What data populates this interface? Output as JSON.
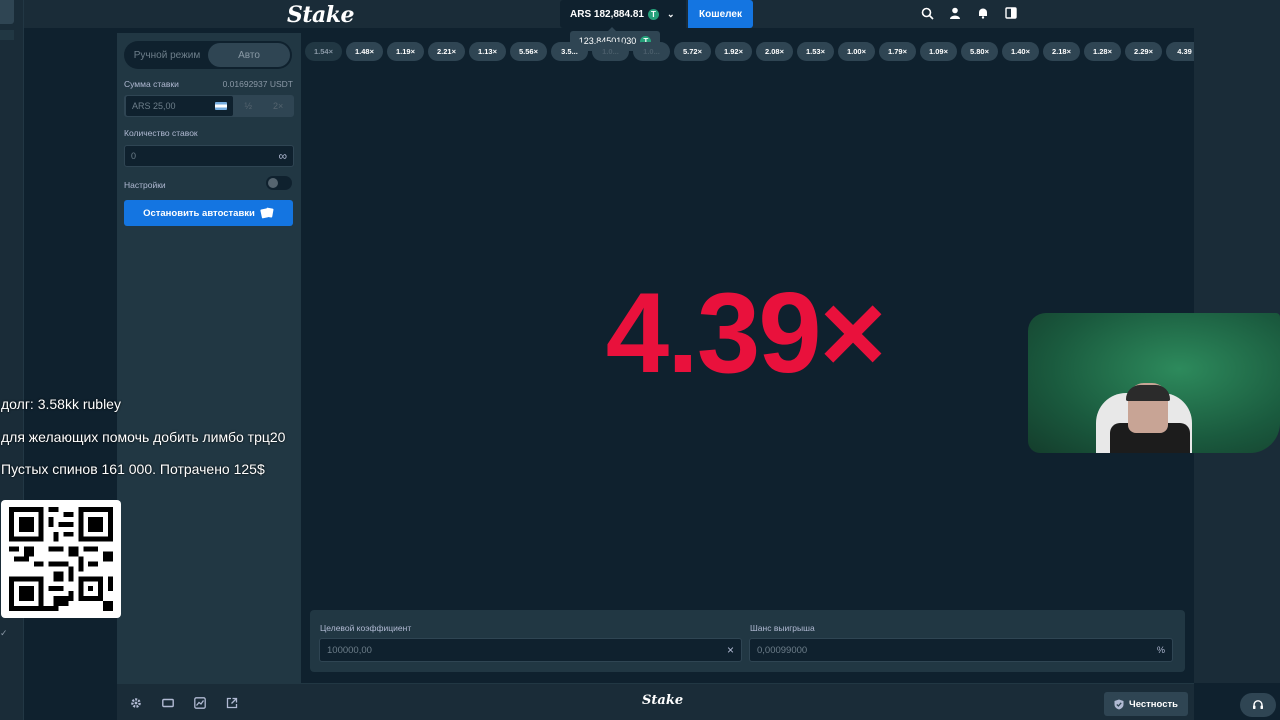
{
  "header": {
    "logo": "Stake",
    "balance": "ARS 182,884.81",
    "balance_currency_icon": "T",
    "wallet_label": "Кошелек",
    "tooltip_value": "123.84501030",
    "icons": [
      "search-icon",
      "user-icon",
      "bell-icon",
      "sidebar-toggle-icon"
    ]
  },
  "sidebar": {
    "mode_manual": "Ручной режим",
    "mode_auto": "Авто",
    "bet_amount_label": "Сумма ставки",
    "bet_amount_usdt": "0.01692937 USDT",
    "bet_input": "ARS 25,00",
    "half_label": "½",
    "double_label": "2×",
    "bet_count_label": "Количество ставок",
    "bet_count_value": "0",
    "infinity_symbol": "∞",
    "settings_label": "Настройки",
    "stop_autobet_label": "Остановить автоставки"
  },
  "history": [
    "1.54×",
    "1.48×",
    "1.19×",
    "2.21×",
    "1.13×",
    "5.56×",
    "3.5...",
    "1.0...",
    "1.0...",
    "5.72×",
    "1.92×",
    "2.08×",
    "1.53×",
    "1.00×",
    "1.79×",
    "1.09×",
    "5.80×",
    "1.40×",
    "2.18×",
    "1.28×",
    "2.29×",
    "4.39"
  ],
  "game": {
    "result_multiplier": "4.39×",
    "result_color": "#e9113c"
  },
  "inputs": {
    "target_multiplier_label": "Целевой коэффициент",
    "target_multiplier_value": "100000,00",
    "win_chance_label": "Шанс выигрыша",
    "win_chance_value": "0,00099000",
    "clear_symbol": "×",
    "percent_symbol": "%"
  },
  "overlay": {
    "line1": "долг: 3.58kk rubley",
    "line2": "для желающих помочь добить лимбо трц20",
    "line3": "Пустых спинов 161 000. Потрачено 125$"
  },
  "footer": {
    "logo": "Stake",
    "fairness_label": "Честность",
    "icons": [
      "settings-icon",
      "theatre-mode-icon",
      "stats-icon",
      "popout-icon"
    ]
  }
}
